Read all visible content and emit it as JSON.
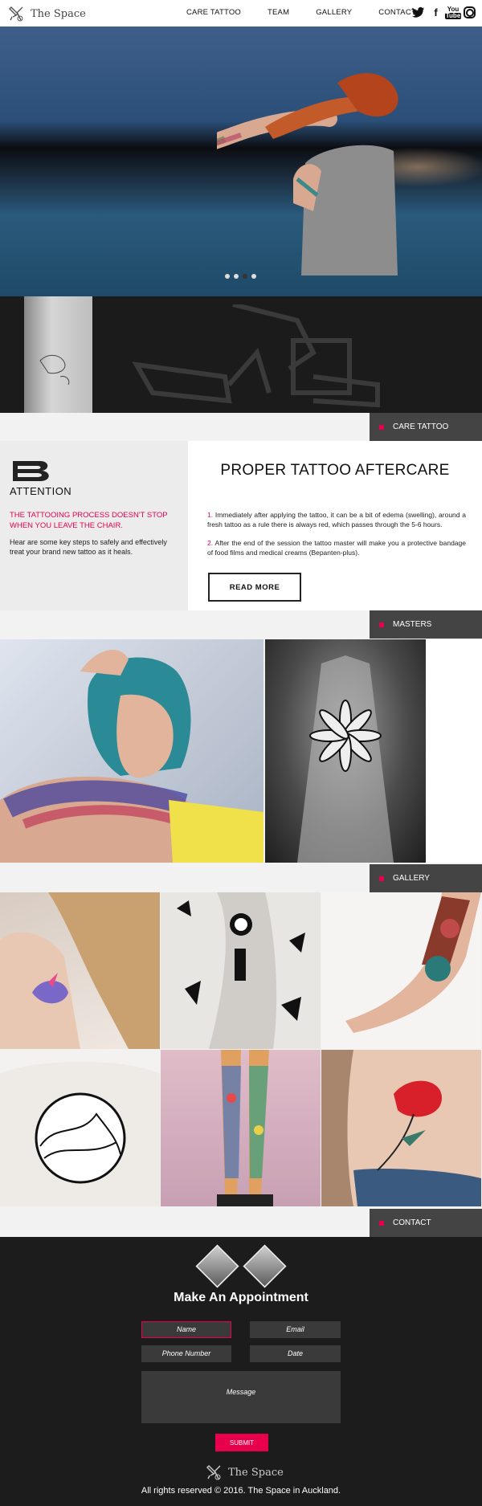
{
  "brand": {
    "name": "The Space"
  },
  "nav": [
    "CARE TATTOO",
    "TEAM",
    "GALLERY",
    "CONTACT"
  ],
  "social": {
    "twitter": "twitter-icon",
    "facebook": "f",
    "youtube_top": "You",
    "youtube_bottom": "Tube",
    "instagram": "instagram-icon"
  },
  "hero": {
    "slides": 4,
    "active_slide": 3
  },
  "tabs": {
    "care": "CARE TATTOO",
    "masters": "MASTERS",
    "gallery": "GALLERY",
    "contact": "CONTACT"
  },
  "care": {
    "attention": "ATTENTION",
    "pink_note": "The tattooing process doesn't stop when you leave the chair.",
    "grey_note": "Hear are some key steps to safely and effectively treat your brand new tattoo as it heals.",
    "title": "PROPER TATTOO AFTERCARE",
    "step1_num": "1.",
    "step1": "Immediately after applying the tattoo, it can be a bit of edema (swelling), around a fresh tattoo as a rule there is always red, which passes through the 5-6 hours.",
    "step2_num": "2.",
    "step2": "After the end of the session the tattoo master will make you a protective bandage of food films and medical creams (Bepanten-plus).",
    "read_more": "READ MORE"
  },
  "contact": {
    "heading": "Make An Appointment",
    "name_placeholder": "Name",
    "email_placeholder": "Email",
    "phone_placeholder": "Phone Number",
    "date_placeholder": "Date",
    "message_placeholder": "Message",
    "submit": "SUBMIT"
  },
  "footer": {
    "brand": "The Space",
    "copyright": "All rights reserved © 2016. The Space in Auckland."
  },
  "colors": {
    "accent": "#e8004d",
    "dark": "#1c1c1d",
    "tab": "#444444"
  }
}
